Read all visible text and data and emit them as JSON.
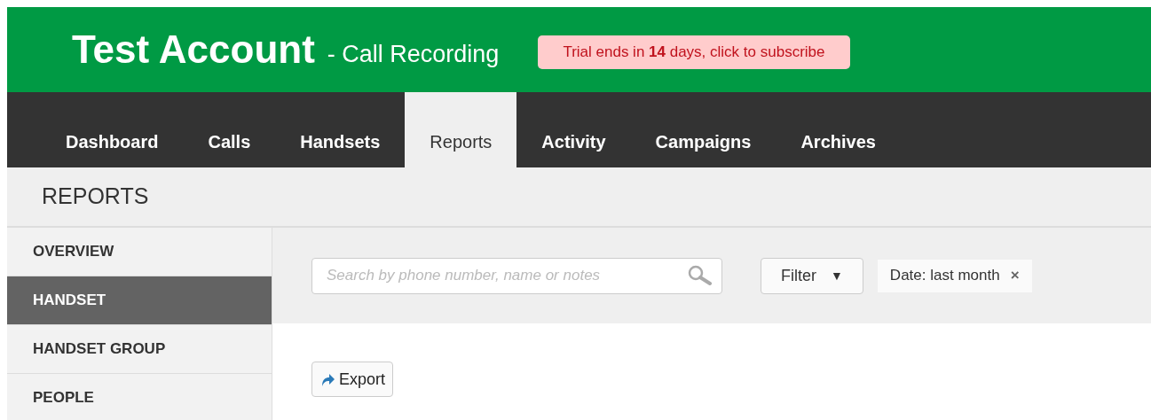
{
  "header": {
    "account": "Test Account",
    "product": "- Call Recording",
    "trial_notice": "Trial ends in **14** days, click to subscribe"
  },
  "tabs": [
    {
      "label": "Dashboard",
      "selected": false
    },
    {
      "label": "Calls",
      "selected": false
    },
    {
      "label": "Handsets",
      "selected": false
    },
    {
      "label": "Reports",
      "selected": true
    },
    {
      "label": "Activity",
      "selected": false
    },
    {
      "label": "Campaigns",
      "selected": false
    },
    {
      "label": "Archives",
      "selected": false
    }
  ],
  "page_title": "REPORTS",
  "sidebar": {
    "items": [
      {
        "label": "OVERVIEW",
        "selected": false
      },
      {
        "label": "HANDSET",
        "selected": true
      },
      {
        "label": "HANDSET GROUP",
        "selected": false
      },
      {
        "label": "PEOPLE",
        "selected": false
      }
    ]
  },
  "toolbar": {
    "search": {
      "placeholder": "Search by phone number, name or notes"
    },
    "filter_button": "Filter",
    "filter_caret": "▼",
    "active_filters": [
      {
        "label": "Date: last month",
        "remove": "×"
      }
    ]
  },
  "export_button": "Export"
}
